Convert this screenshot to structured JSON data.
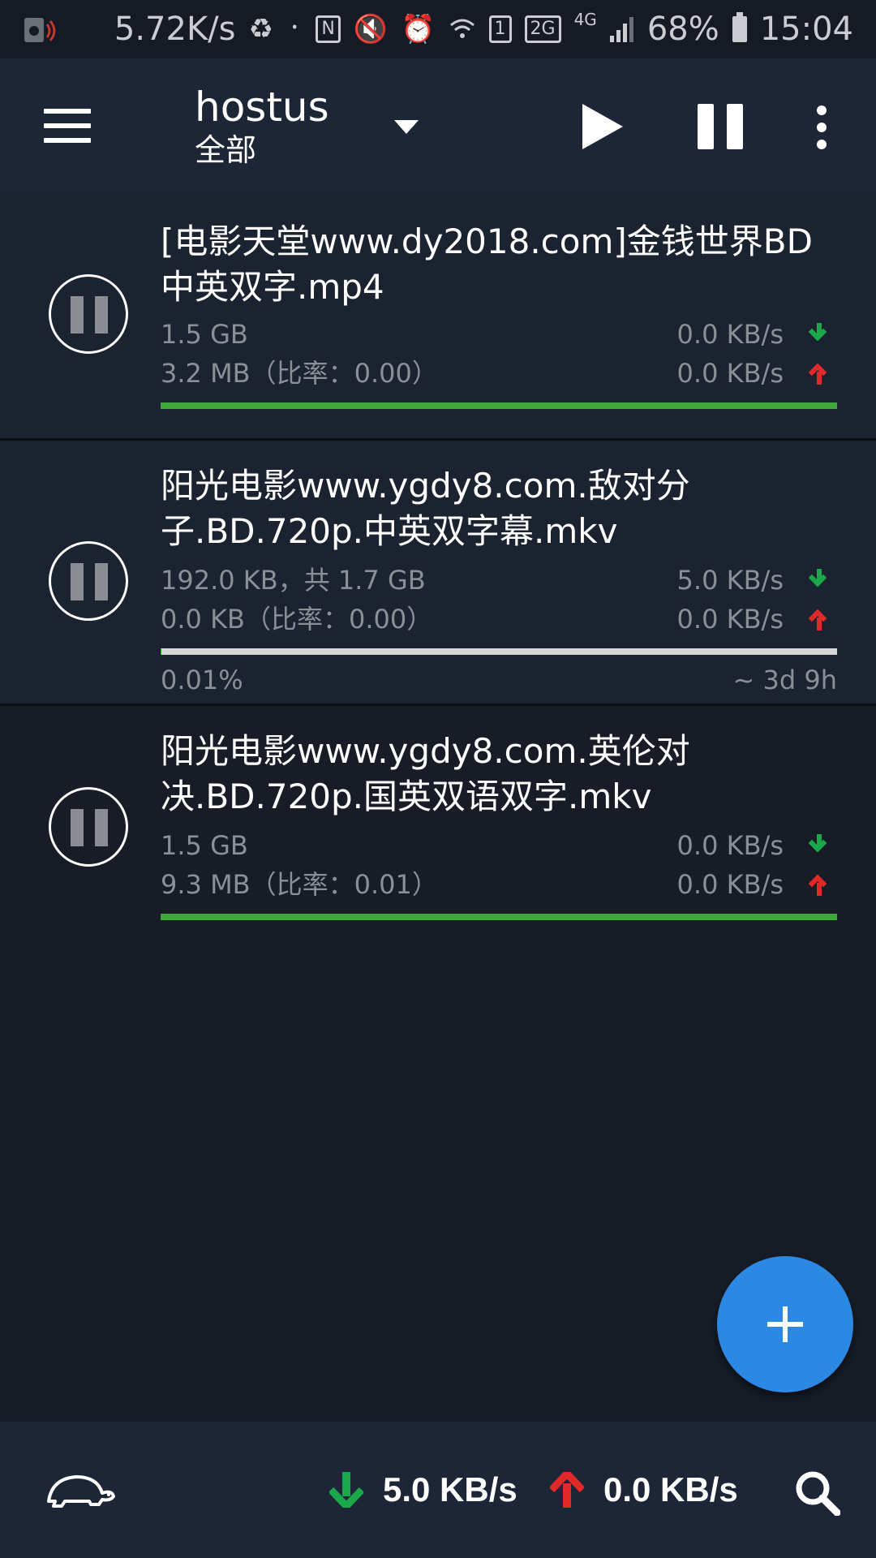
{
  "status_bar": {
    "net_speed": "5.72K/s",
    "sim_label": "1",
    "network_2g": "2G",
    "network_4g": "4G",
    "battery": "68%",
    "time": "15:04"
  },
  "app_bar": {
    "title": "hostus",
    "subtitle": "全部"
  },
  "torrents": [
    {
      "name": "[电影天堂www.dy2018.com]金钱世界BD中英双字.mp4",
      "size_line": "1.5 GB",
      "upload_line": "3.2 MB（比率：0.00）",
      "down_speed": "0.0 KB/s",
      "up_speed": "0.0 KB/s",
      "progress": 1.0,
      "status": "completed"
    },
    {
      "name": "阳光电影www.ygdy8.com.敌对分子.BD.720p.中英双字幕.mkv",
      "size_line": "192.0 KB，共 1.7 GB",
      "upload_line": "0.0 KB（比率：0.00）",
      "down_speed": "5.0 KB/s",
      "up_speed": "0.0 KB/s",
      "progress": 0.0001,
      "percent_label": "0.01%",
      "eta": "~ 3d 9h",
      "status": "downloading"
    },
    {
      "name": "阳光电影www.ygdy8.com.英伦对决.BD.720p.国英双语双字.mkv",
      "size_line": "1.5 GB",
      "upload_line": "9.3 MB（比率：0.01）",
      "down_speed": "0.0 KB/s",
      "up_speed": "0.0 KB/s",
      "progress": 1.0,
      "status": "completed"
    }
  ],
  "bottom_bar": {
    "total_down": "5.0 KB/s",
    "total_up": "0.0 KB/s"
  },
  "colors": {
    "background": "#171c27",
    "app_bar": "#1d2636",
    "progress_complete": "#3ea83b",
    "progress_track": "#d6d6d6",
    "down_arrow": "#1aa84b",
    "up_arrow": "#e02a2a",
    "fab": "#2b88e3",
    "secondary_text": "#8b8f96"
  },
  "icons": {
    "status_left": "screen-record-icon",
    "menu": "hamburger-menu-icon",
    "dropdown": "dropdown-triangle-icon",
    "play_all": "play-icon",
    "pause_all": "pause-icon",
    "overflow": "more-vertical-icon",
    "item_pause": "pause-circle-icon",
    "fab": "add-icon",
    "speed_limit": "turtle-icon",
    "search": "search-icon"
  }
}
